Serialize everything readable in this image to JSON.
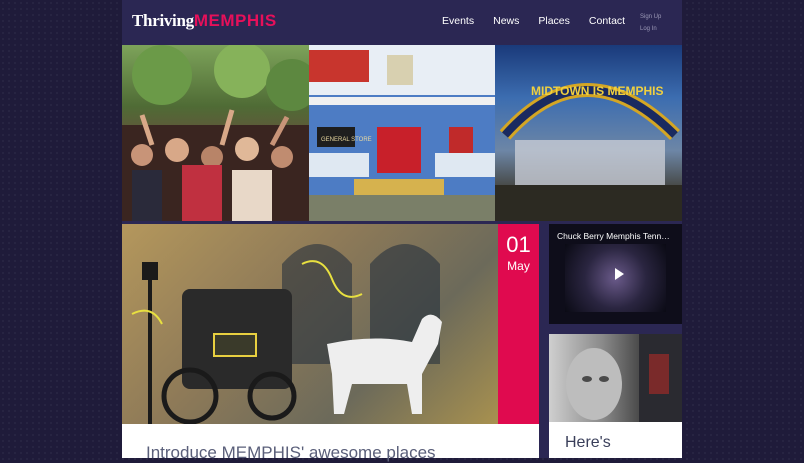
{
  "header": {
    "logo_word1": "Thriving",
    "logo_word2": "MEMPHIS",
    "nav": [
      {
        "label": "Events"
      },
      {
        "label": "News"
      },
      {
        "label": "Places"
      },
      {
        "label": "Contact"
      }
    ],
    "signup_label": "Sign Up",
    "login_label": "Log In"
  },
  "banner": {
    "photo2_sign_text": "GENERAL STORE",
    "photo3_sign_text": "MIDTOWN IS MEMPHIS"
  },
  "featured": {
    "day": "01",
    "month": "May",
    "title": "Introduce MEMPHIS' awesome places"
  },
  "sidebar": {
    "video_title": "Chuck Berry Memphis Tenn…",
    "card_title": "Here's"
  },
  "colors": {
    "background": "#1f1b3a",
    "panel": "#2b2753",
    "accent": "#e00a4f",
    "logo_pink": "#e6105a"
  }
}
